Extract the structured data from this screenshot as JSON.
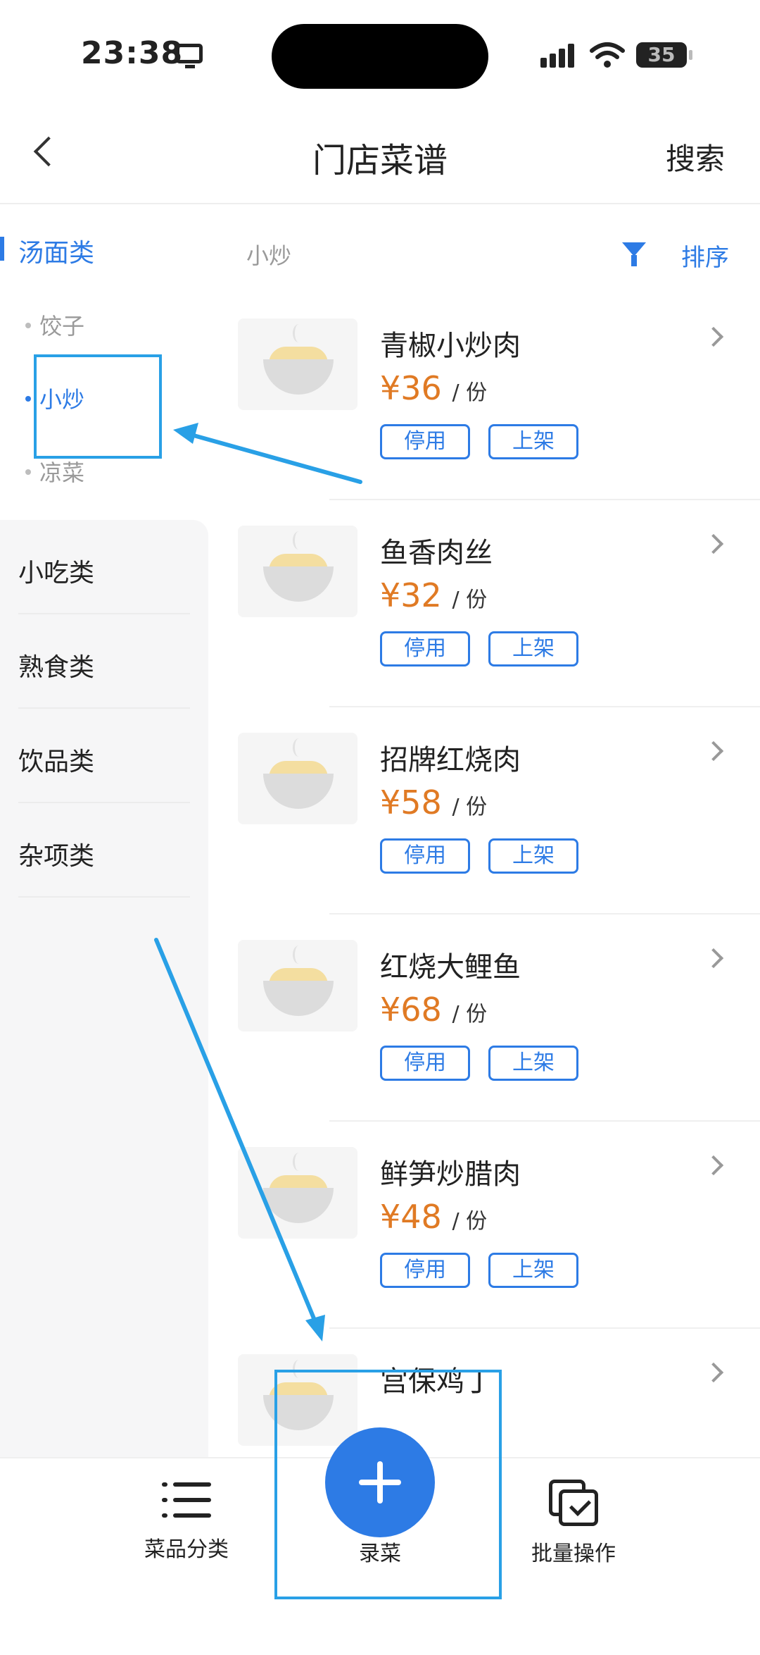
{
  "status_bar": {
    "time": "23:38",
    "battery": "35"
  },
  "header": {
    "title": "门店菜谱",
    "search_label": "搜索"
  },
  "sidebar": {
    "active_category": "汤面类",
    "subcategories": [
      {
        "label": "饺子",
        "active": false
      },
      {
        "label": "小炒",
        "active": true
      },
      {
        "label": "凉菜",
        "active": false
      }
    ],
    "categories": [
      "小吃类",
      "熟食类",
      "饮品类",
      "杂项类"
    ]
  },
  "content": {
    "section_label": "小炒",
    "sort_label": "排序",
    "dishes": [
      {
        "name": "青椒小炒肉",
        "price": "¥36",
        "unit": "/ 份",
        "stop_label": "停用",
        "list_label": "上架"
      },
      {
        "name": "鱼香肉丝",
        "price": "¥32",
        "unit": "/ 份",
        "stop_label": "停用",
        "list_label": "上架"
      },
      {
        "name": "招牌红烧肉",
        "price": "¥58",
        "unit": "/ 份",
        "stop_label": "停用",
        "list_label": "上架"
      },
      {
        "name": "红烧大鲤鱼",
        "price": "¥68",
        "unit": "/ 份",
        "stop_label": "停用",
        "list_label": "上架"
      },
      {
        "name": "鲜笋炒腊肉",
        "price": "¥48",
        "unit": "/ 份",
        "stop_label": "停用",
        "list_label": "上架"
      },
      {
        "name": "宫保鸡丁"
      }
    ]
  },
  "bottom_bar": {
    "category_label": "菜品分类",
    "add_label": "录菜",
    "batch_label": "批量操作"
  },
  "colors": {
    "accent": "#2d7be5",
    "price": "#e07a24",
    "annotation": "#29a0e6"
  }
}
